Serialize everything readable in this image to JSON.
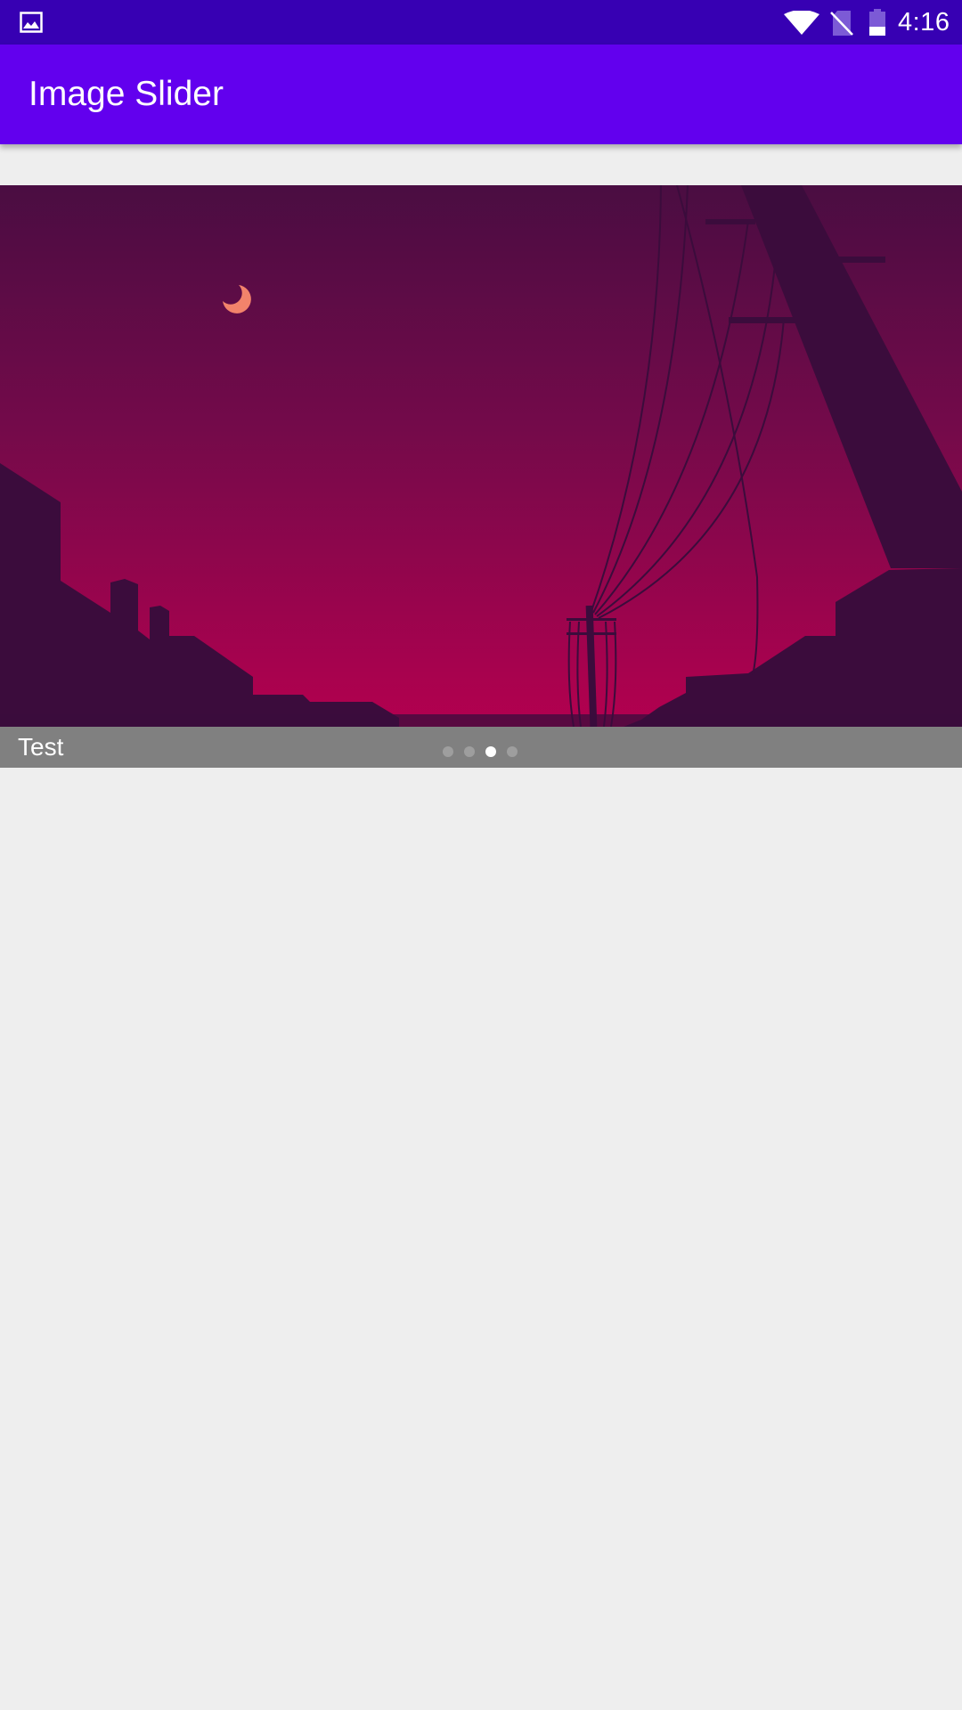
{
  "status_bar": {
    "time": "4:16",
    "icons": [
      "image-notification-icon",
      "wifi-icon",
      "no-sim-icon",
      "battery-icon"
    ]
  },
  "app_bar": {
    "title": "Image Slider",
    "color": "#6200ee"
  },
  "slider": {
    "caption": "Test",
    "dot_count": 4,
    "active_dot": 3,
    "caption_background": "#808080"
  },
  "colors": {
    "status_bar": "#3700b3",
    "app_bar": "#6200ee",
    "background": "#eeeeee"
  }
}
